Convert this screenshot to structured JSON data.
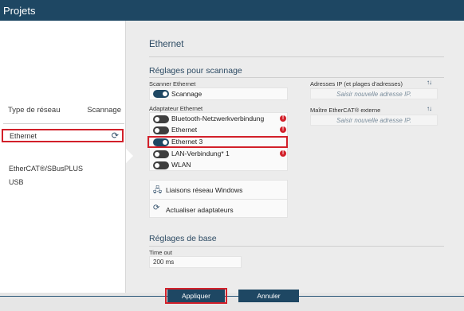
{
  "titlebar": {
    "title": "Projets"
  },
  "sidebar": {
    "header_type": "Type de réseau",
    "header_scan": "Scannage",
    "items": [
      {
        "label": "Ethernet",
        "selected": true
      },
      {
        "label": "EtherCAT®/SBusPLUS"
      },
      {
        "label": "USB"
      }
    ]
  },
  "main": {
    "title": "Ethernet",
    "scan_section": {
      "title": "Réglages pour scannage",
      "scanner_label": "Scanner Ethernet",
      "scanner_toggle": {
        "label": "Scannage",
        "on": true
      },
      "adapter_label": "Adaptateur Ethernet",
      "adapters": [
        {
          "label": "Bluetooth-Netzwerkverbindung",
          "on": false,
          "warning": true
        },
        {
          "label": "Ethernet",
          "on": false,
          "warning": true
        },
        {
          "label": "Ethernet 3",
          "on": true,
          "warning": false
        },
        {
          "label": "LAN-Verbindung* 1",
          "on": false,
          "warning": true
        },
        {
          "label": "WLAN",
          "on": false,
          "warning": false
        }
      ],
      "ip_label": "Adresses IP (et plages d'adresses)",
      "ip_placeholder": "Saisir nouvelle adresse IP.",
      "master_label": "Maître EtherCAT® externe",
      "master_placeholder": "Saisir nouvelle adresse IP."
    },
    "actions": {
      "windows_connections": "Liaisons réseau Windows",
      "refresh_adapters": "Actualiser adaptateurs"
    },
    "base_section": {
      "title": "Réglages de base",
      "timeout_label": "Time out",
      "timeout_value": "200 ms"
    }
  },
  "footer": {
    "apply_label": "Appliquer",
    "cancel_label": "Annuler"
  },
  "colors": {
    "accent": "#1e4763",
    "highlight": "#d2202a",
    "warning": "#d2202a"
  }
}
